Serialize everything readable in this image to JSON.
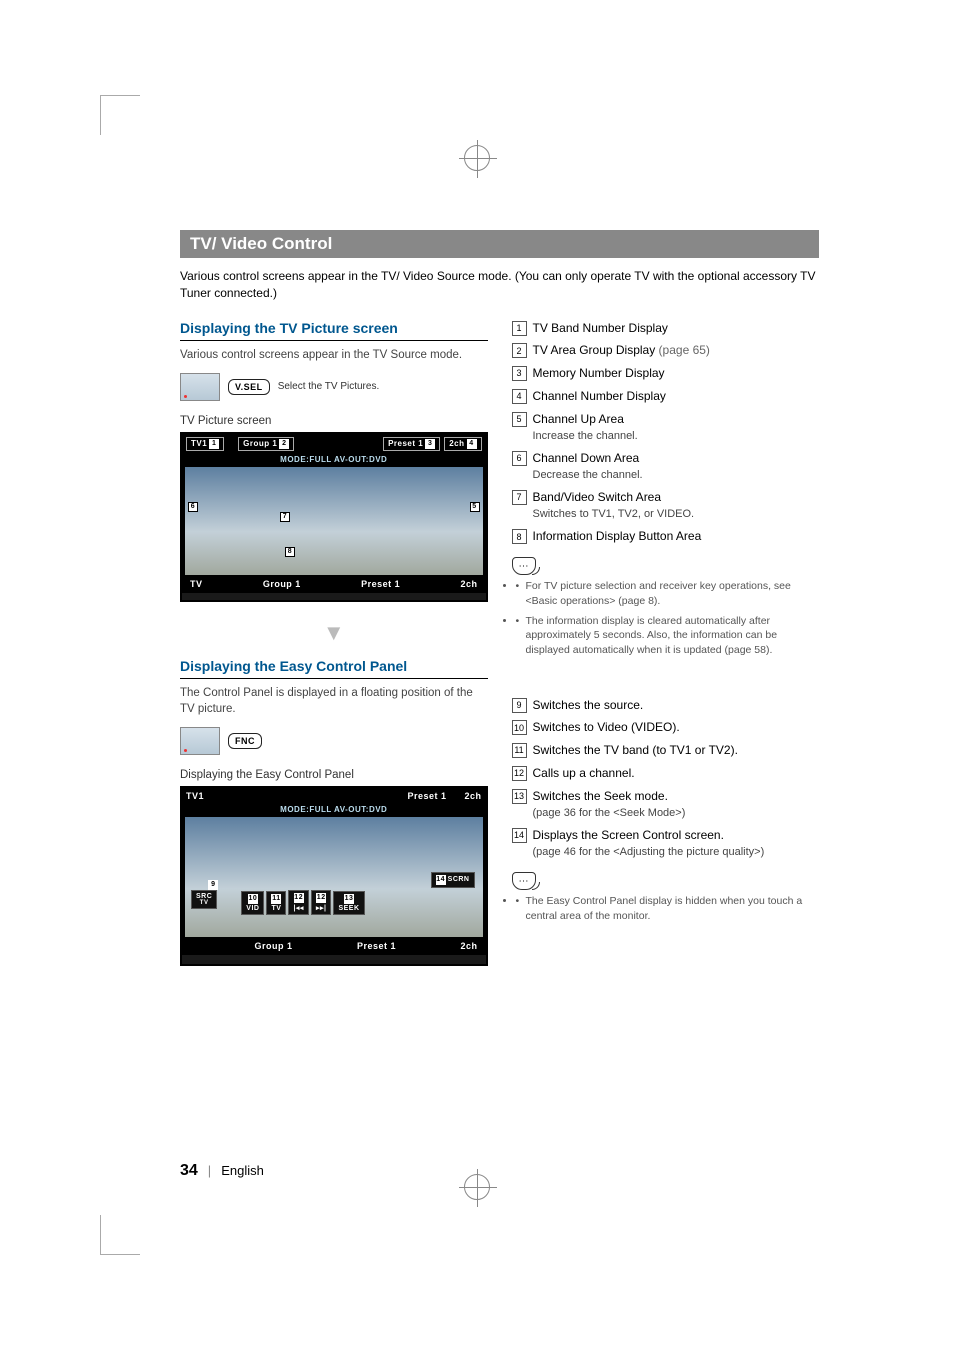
{
  "section_title": "TV/ Video Control",
  "intro": "Various control screens appear in the TV/ Video Source mode. (You can only operate TV with the optional accessory TV Tuner connected.)",
  "block1": {
    "heading": "Displaying the TV Picture screen",
    "desc": "Various control screens appear in the TV Source mode.",
    "vsel": "V.SEL",
    "vsel_hint": "Select the TV Pictures.",
    "figure_title": "TV Picture screen",
    "shot": {
      "tv1": "TV1",
      "group": "Group 1",
      "preset": "Preset 1",
      "ch": "2ch",
      "mode": "MODE:FULL  AV-OUT:DVD",
      "bot_tv": "TV",
      "bot_group": "Group 1",
      "bot_preset": "Preset 1",
      "bot_ch": "2ch"
    }
  },
  "list1": [
    {
      "n": "1",
      "t": "TV Band Number Display"
    },
    {
      "n": "2",
      "t": "TV Area Group Display",
      "note": " (page 65)"
    },
    {
      "n": "3",
      "t": "Memory Number Display"
    },
    {
      "n": "4",
      "t": "Channel Number Display"
    },
    {
      "n": "5",
      "t": "Channel Up Area",
      "d": "Increase the channel."
    },
    {
      "n": "6",
      "t": "Channel Down Area",
      "d": "Decrease the channel."
    },
    {
      "n": "7",
      "t": "Band/Video Switch Area",
      "d": "Switches to TV1, TV2, or VIDEO."
    },
    {
      "n": "8",
      "t": "Information Display Button Area"
    }
  ],
  "notes1": [
    "For TV picture selection and receiver key operations, see <Basic operations> (page 8).",
    "The information display is cleared automatically after approximately 5 seconds. Also, the information can be displayed automatically when it is updated (page 58)."
  ],
  "block2": {
    "heading": "Displaying the Easy Control Panel",
    "desc": "The Control Panel is displayed in a floating position of the TV picture.",
    "fnc": "FNC",
    "figure_title": "Displaying the Easy Control Panel",
    "shot": {
      "tv1": "TV1",
      "preset": "Preset 1",
      "ch": "2ch",
      "mode": "MODE:FULL  AV-OUT:DVD",
      "scrn": "SCRN",
      "src": "SRC",
      "src_sub": "TV",
      "vid": "VID",
      "tvb": "TV",
      "prev": "|◂◂",
      "next": "▸▸|",
      "seek": "SEEK",
      "bot_group": "Group 1",
      "bot_preset": "Preset 1",
      "bot_ch": "2ch"
    }
  },
  "list2": [
    {
      "n": "9",
      "t": "Switches the source."
    },
    {
      "n": "10",
      "t": "Switches to Video (VIDEO)."
    },
    {
      "n": "11",
      "t": "Switches the TV band (to TV1 or TV2)."
    },
    {
      "n": "12",
      "t": "Calls up a channel."
    },
    {
      "n": "13",
      "t": "Switches the Seek mode.",
      "d": "(page 36 for the <Seek Mode>)"
    },
    {
      "n": "14",
      "t": "Displays the Screen Control screen.",
      "d": "(page 46 for the <Adjusting the picture quality>)"
    }
  ],
  "notes2": [
    "The Easy Control Panel display is hidden when you touch a central area of the monitor."
  ],
  "footer": {
    "page": "34",
    "lang": "English"
  }
}
